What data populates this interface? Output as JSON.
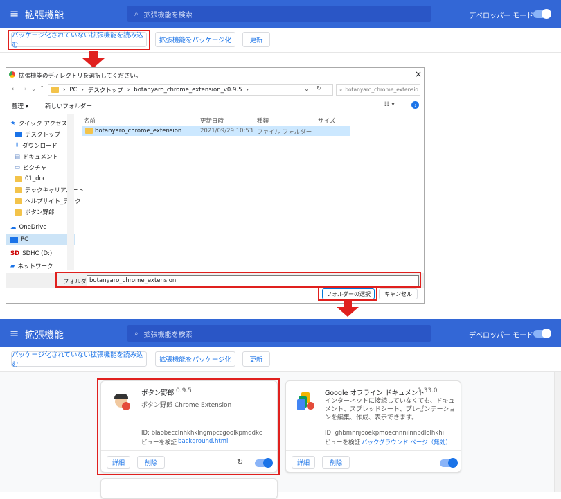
{
  "top": {
    "title": "拡張機能",
    "search_placeholder": "拡張機能を検索",
    "dev_mode": "デベロッパー モード",
    "load_btn": "パッケージ化されていない拡張機能を読み込む",
    "pack_btn": "拡張機能をパッケージ化",
    "update_btn": "更新"
  },
  "dialog": {
    "title": "拡張機能のディレクトリを選択してください。",
    "close": "×",
    "breadcrumb": [
      "PC",
      "デスクトップ",
      "botanyaro_chrome_extension_v0.9.5"
    ],
    "search_placeholder": "botanyaro_chrome_extensio...",
    "organize": "整理 ▾",
    "new_folder": "新しいフォルダー",
    "sidebar": [
      "クイック アクセス",
      "デスクトップ",
      "ダウンロード",
      "ドキュメント",
      "ピクチャ",
      "01_doc",
      "テックキャリアパート",
      "ヘルプサイト_テック",
      "ボタン野郎",
      "OneDrive",
      "PC",
      "SDHC (D:)",
      "ネットワーク"
    ],
    "columns": [
      "名前",
      "更新日時",
      "種類",
      "サイズ"
    ],
    "row": {
      "name": "botanyaro_chrome_extension",
      "date": "2021/09/29 10:53",
      "type": "ファイル フォルダー",
      "size": ""
    },
    "folder_label": "フォルダー:",
    "folder_value": "botanyaro_chrome_extension",
    "select_btn": "フォルダーの選択",
    "cancel_btn": "キャンセル"
  },
  "bottom": {
    "title": "拡張機能",
    "search_placeholder": "拡張機能を検索",
    "dev_mode": "デベロッパー モード",
    "load_btn": "パッケージ化されていない拡張機能を読み込む",
    "pack_btn": "拡張機能をパッケージ化",
    "update_btn": "更新"
  },
  "cards": [
    {
      "name": "ボタン野郎",
      "version": "0.9.5",
      "desc": "ボタン野郎 Chrome Extension",
      "id": "ID: blaobeccInhkhklngmpccgoolkpmddkc",
      "view_prefix": "ビューを検証",
      "view_link": "background.html",
      "details": "詳細",
      "remove": "削除"
    },
    {
      "name": "Google オフライン ドキュメント",
      "version": "1.33.0",
      "desc": "インターネットに接続していなくても、ドキュメント、スプレッドシート、プレゼンテーションを編集、作成、表示できます。",
      "id": "ID: ghbmnnjooekpmoecnnnilnnbdlolhkhi",
      "view_prefix": "ビューを検証",
      "view_link": "バックグラウンド ページ（無効）",
      "details": "詳細",
      "remove": "削除"
    }
  ],
  "colors": {
    "accent": "#3367d6",
    "highlight": "#e0201e",
    "link": "#1a73e8"
  }
}
